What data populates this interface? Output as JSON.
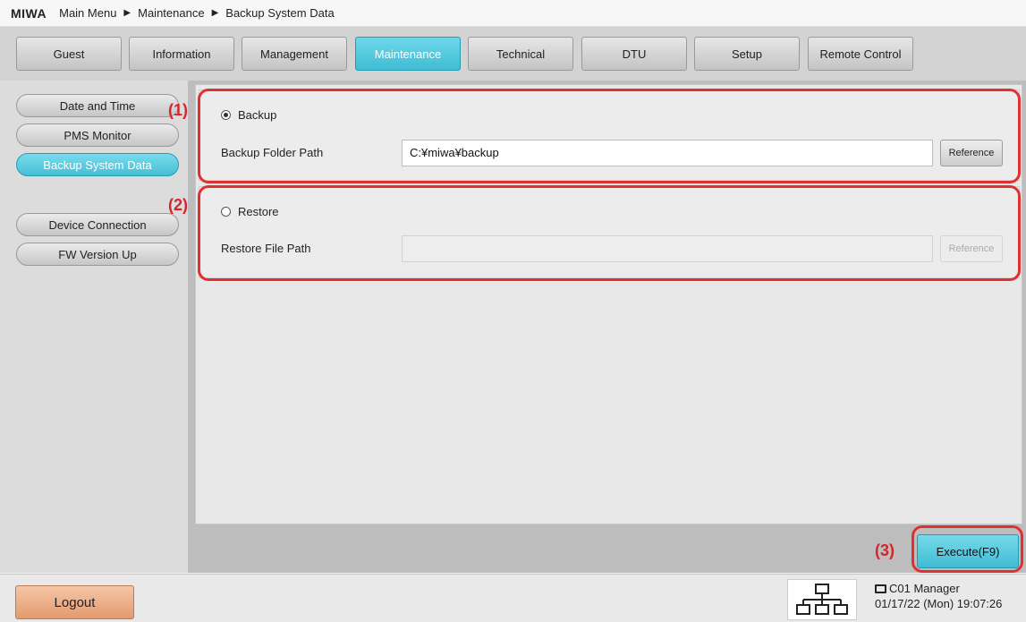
{
  "header": {
    "brand": "MIWA",
    "breadcrumb": [
      "Main Menu",
      "Maintenance",
      "Backup System Data"
    ]
  },
  "tabs": [
    "Guest",
    "Information",
    "Management",
    "Maintenance",
    "Technical",
    "DTU",
    "Setup",
    "Remote Control"
  ],
  "active_tab": "Maintenance",
  "sidebar": {
    "items": [
      "Date and Time",
      "PMS Monitor",
      "Backup System Data",
      "Device Connection",
      "FW Version Up"
    ],
    "active_item": "Backup System Data"
  },
  "backup": {
    "option_label": "Backup",
    "selected": true,
    "path_label": "Backup Folder Path",
    "path_value": "C:¥miwa¥backup",
    "reference_label": "Reference"
  },
  "restore": {
    "option_label": "Restore",
    "selected": false,
    "path_label": "Restore File Path",
    "path_value": "",
    "reference_label": "Reference"
  },
  "annotations": [
    "(1)",
    "(2)",
    "(3)"
  ],
  "execute_label": "Execute(F9)",
  "footer": {
    "logout_label": "Logout",
    "terminal_user": "C01 Manager",
    "datetime": "01/17/22 (Mon) 19:07:26"
  },
  "colors": {
    "accent": "#45bfd6",
    "annotation": "#e03030",
    "logout": "#e49a6e"
  },
  "icons": {
    "breadcrumb_separator": "triangle-right-icon",
    "network": "network-icon",
    "terminal": "pc-icon"
  }
}
